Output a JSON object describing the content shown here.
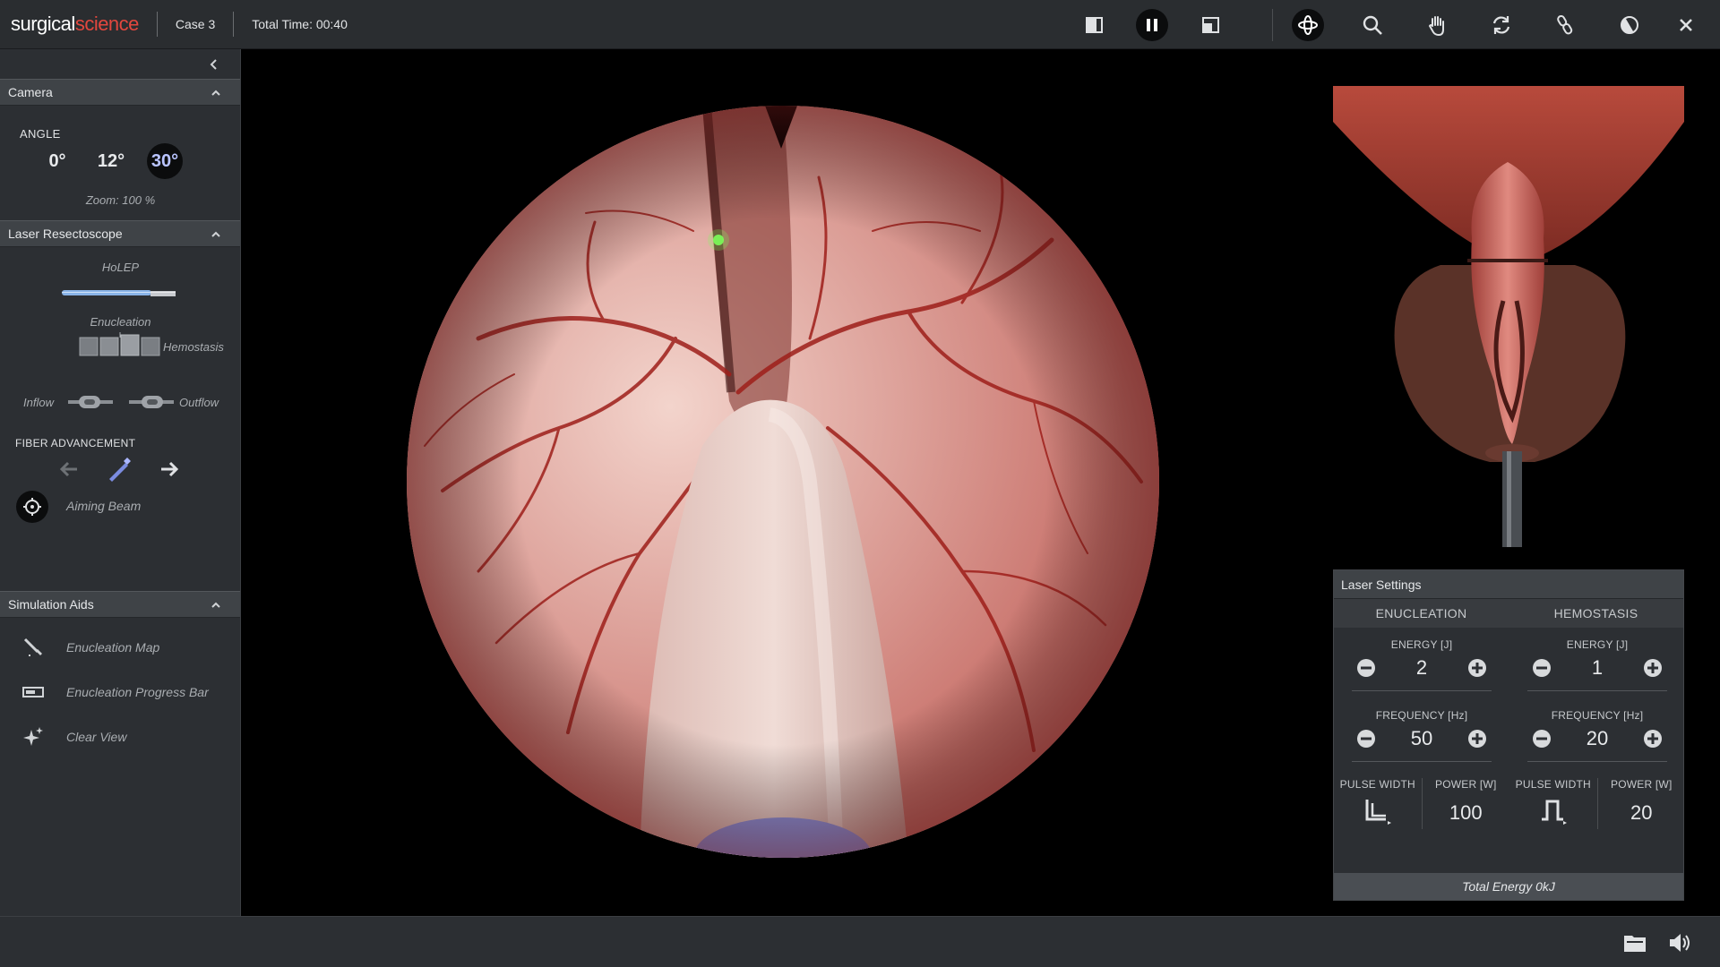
{
  "header": {
    "logo_part1": "surgical",
    "logo_part2": "science",
    "case": "Case 3",
    "timer": "Total Time: 00:40",
    "icons": [
      "layout-left-icon",
      "pause-icon",
      "layout-right-icon",
      "rotate-3d-icon",
      "zoom-icon",
      "hand-icon",
      "refresh-icon",
      "link-icon",
      "contrast-icon",
      "close-icon"
    ]
  },
  "left_panel": {
    "camera": {
      "title": "Camera",
      "angle_label": "ANGLE",
      "angles": [
        "0°",
        "12°",
        "30°"
      ],
      "active_angle": "30°",
      "zoom": "Zoom: 100 %"
    },
    "laser_resectoscope": {
      "title": "Laser Resectoscope",
      "instrument": "HoLEP",
      "mode_left": "Enucleation",
      "mode_right": "Hemostasis",
      "inflow": "Inflow",
      "outflow": "Outflow",
      "fiber_label": "FIBER ADVANCEMENT",
      "aiming_beam": "Aiming Beam"
    },
    "simulation_aids": {
      "title": "Simulation Aids",
      "items": [
        "Enucleation Map",
        "Enucleation Progress Bar",
        "Clear View"
      ]
    }
  },
  "laser_settings": {
    "title": "Laser Settings",
    "columns": [
      "ENUCLEATION",
      "HEMOSTASIS"
    ],
    "enucleation": {
      "energy_label": "ENERGY [J]",
      "energy": "2",
      "frequency_label": "FREQUENCY [Hz]",
      "frequency": "50",
      "pulse_label": "PULSE WIDTH",
      "power_label": "POWER [W]",
      "power": "100"
    },
    "hemostasis": {
      "energy_label": "ENERGY [J]",
      "energy": "1",
      "frequency_label": "FREQUENCY [Hz]",
      "frequency": "20",
      "pulse_label": "PULSE WIDTH",
      "power_label": "POWER [W]",
      "power": "20"
    },
    "total_energy": "Total Energy 0kJ"
  },
  "colors": {
    "accent_red": "#e2473e",
    "active_angle": "#b9c4ff",
    "panel_bg": "#2c2f33",
    "header_bg": "#2a2d30"
  }
}
